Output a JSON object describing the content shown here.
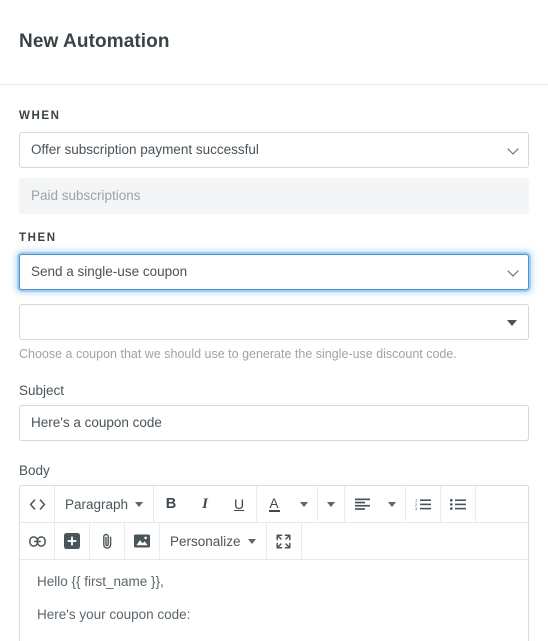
{
  "header": {
    "title": "New Automation"
  },
  "when": {
    "label": "WHEN",
    "trigger_value": "Offer subscription payment successful",
    "scope_value": "Paid subscriptions"
  },
  "then": {
    "label": "THEN",
    "action_value": "Send a single-use coupon",
    "coupon_value": "",
    "coupon_helper": "Choose a coupon that we should use to generate the single-use discount code."
  },
  "subject": {
    "label": "Subject",
    "value": "Here's a coupon code"
  },
  "body": {
    "label": "Body",
    "toolbar_row1": [
      {
        "name": "source-code-icon",
        "label": "<>"
      },
      {
        "name": "paragraph-style-dropdown",
        "label": "Paragraph"
      },
      {
        "name": "bold-icon",
        "label": "B"
      },
      {
        "name": "italic-icon",
        "label": "I"
      },
      {
        "name": "underline-icon",
        "label": "U"
      },
      {
        "name": "text-color-icon",
        "label": "A"
      },
      {
        "name": "highlight-color-dropdown",
        "label": ""
      },
      {
        "name": "align-left-icon",
        "label": ""
      },
      {
        "name": "ordered-list-icon",
        "label": ""
      },
      {
        "name": "unordered-list-icon",
        "label": ""
      }
    ],
    "toolbar_row2": [
      {
        "name": "link-icon",
        "label": ""
      },
      {
        "name": "insert-block-icon",
        "label": ""
      },
      {
        "name": "attachment-icon",
        "label": ""
      },
      {
        "name": "image-icon",
        "label": ""
      },
      {
        "name": "personalize-dropdown",
        "label": "Personalize"
      },
      {
        "name": "fullscreen-icon",
        "label": ""
      }
    ],
    "content_lines": [
      "Hello {{ first_name }},",
      "Here's your coupon code:"
    ]
  },
  "colors": {
    "focus_blue": "#4a92cf",
    "border": "#d3d8da",
    "text": "#48535a",
    "muted": "#9aa5ab",
    "readonly_bg": "#f3f5f7"
  }
}
